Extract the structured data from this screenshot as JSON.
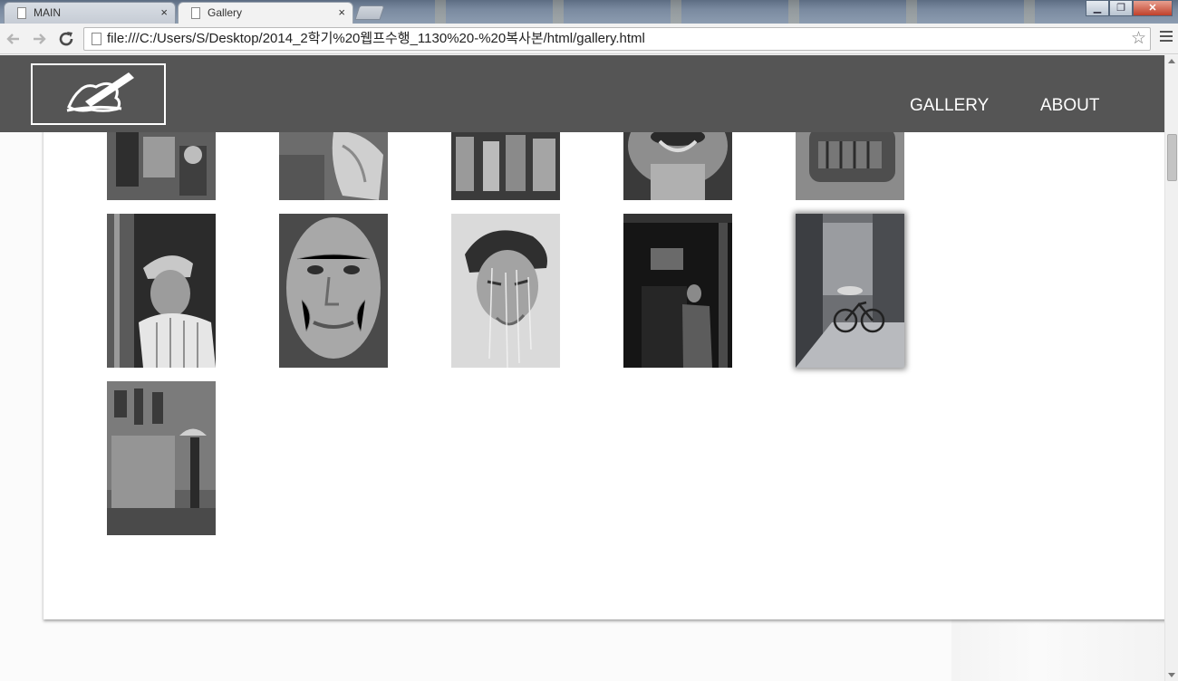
{
  "browser": {
    "tabs": [
      {
        "title": "MAIN",
        "active": false
      },
      {
        "title": "Gallery",
        "active": true
      }
    ],
    "tab_close_glyph": "×",
    "url": "file:///C:/Users/S/Desktop/2014_2학기%20웹프수행_1130%20-%20복사본/html/gallery.html",
    "window_buttons": {
      "minimize": "▁",
      "maximize": "❐",
      "close": "✕"
    },
    "icons": {
      "back": "back-arrow-icon",
      "forward": "forward-arrow-icon",
      "reload": "reload-icon",
      "bookmark": "star-icon",
      "menu": "hamburger-menu-icon"
    }
  },
  "site": {
    "logo_alt": "hand-writing-logo",
    "nav": [
      {
        "label": "GALLERY"
      },
      {
        "label": "ABOUT"
      }
    ],
    "colors": {
      "header": "#555555",
      "nav_text": "#ffffff"
    }
  },
  "gallery": {
    "photos": [
      {
        "subject": "street market clutter",
        "partial": true
      },
      {
        "subject": "plastic bag on ground",
        "partial": true
      },
      {
        "subject": "market stalls crowd",
        "partial": true
      },
      {
        "subject": "mouth close-up",
        "partial": true
      },
      {
        "subject": "old car front",
        "partial": true
      },
      {
        "subject": "old man in hat"
      },
      {
        "subject": "elderly woman portrait"
      },
      {
        "subject": "man under running water"
      },
      {
        "subject": "man in dark bar"
      },
      {
        "subject": "alley with bicycle",
        "selected": true
      },
      {
        "subject": "person with umbrella by wall"
      }
    ]
  }
}
